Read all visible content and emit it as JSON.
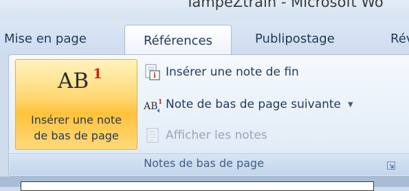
{
  "window": {
    "title": "TampéZtrain - Microsoft Wo"
  },
  "tabs": [
    {
      "label": "Mise en page"
    },
    {
      "label": "Références",
      "active": true
    },
    {
      "label": "Publipostage"
    },
    {
      "label": "Rév"
    }
  ],
  "ribbon": {
    "group_label": "Notes de bas de page",
    "big_button": {
      "label_line1": "Insérer une note",
      "label_line2": "de bas de page",
      "graphic_text": "AB",
      "graphic_sup": "1",
      "icon": "footnote-icon"
    },
    "small_buttons": [
      {
        "label": "Insérer une note de fin",
        "icon": "endnote-icon",
        "enabled": true
      },
      {
        "label": "Note de bas de page suivante",
        "icon": "next-footnote-icon",
        "enabled": true,
        "has_dropdown": true
      },
      {
        "label": "Afficher les notes",
        "icon": "show-notes-icon",
        "enabled": false
      }
    ]
  },
  "colors": {
    "tab_text": "#1e395b",
    "highlight": "#ffc23a",
    "superscript_red": "#c8261b",
    "disabled_text": "#9aa6b4"
  }
}
